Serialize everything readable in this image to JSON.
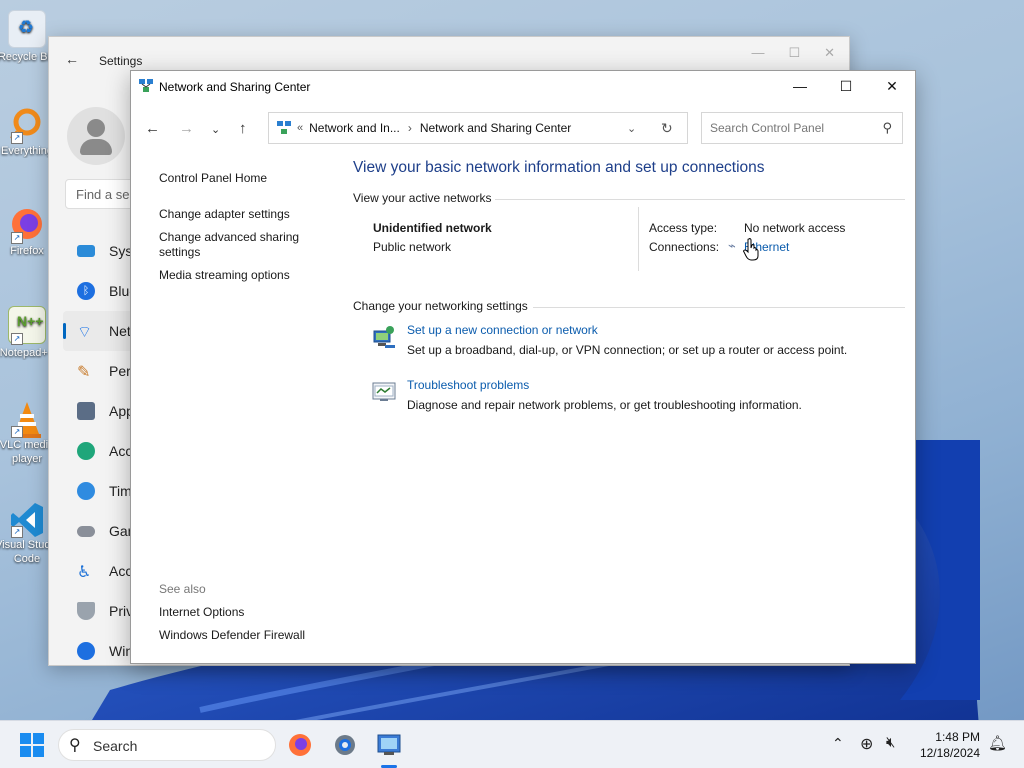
{
  "desktop": {
    "icons": [
      {
        "label": "Recycle Bin"
      },
      {
        "label": "Everything"
      },
      {
        "label": "Firefox"
      },
      {
        "label": "Notepad++"
      },
      {
        "label": "VLC media player"
      },
      {
        "label": "Visual Studio Code"
      }
    ]
  },
  "settings": {
    "title": "Settings",
    "find_placeholder": "Find a se",
    "nav": [
      "Syst",
      "Blue",
      "Net",
      "Pers",
      "App",
      "Acc",
      "Tim",
      "Gar",
      "Acc",
      "Priv",
      "Win"
    ]
  },
  "nsc": {
    "window_title": "Network and Sharing Center",
    "breadcrumb_root": "Network and In...",
    "breadcrumb_current": "Network and Sharing Center",
    "search_placeholder": "Search Control Panel",
    "left_links": [
      "Control Panel Home",
      "Change adapter settings",
      "Change advanced sharing settings",
      "Media streaming options"
    ],
    "see_also_label": "See also",
    "see_also": [
      "Internet Options",
      "Windows Defender Firewall"
    ],
    "heading": "View your basic network information and set up connections",
    "active_networks_label": "View your active networks",
    "network_name": "Unidentified network",
    "network_profile": "Public network",
    "access_type_label": "Access type:",
    "access_type_value": "No network access",
    "connections_label": "Connections:",
    "connections_value": "Ethernet",
    "change_settings_label": "Change your networking settings",
    "tasks": [
      {
        "title": "Set up a new connection or network",
        "desc": "Set up a broadband, dial-up, or VPN connection; or set up a router or access point."
      },
      {
        "title": "Troubleshoot problems",
        "desc": "Diagnose and repair network problems, or get troubleshooting information."
      }
    ]
  },
  "taskbar": {
    "search_label": "Search",
    "time": "1:48 PM",
    "date": "12/18/2024"
  }
}
